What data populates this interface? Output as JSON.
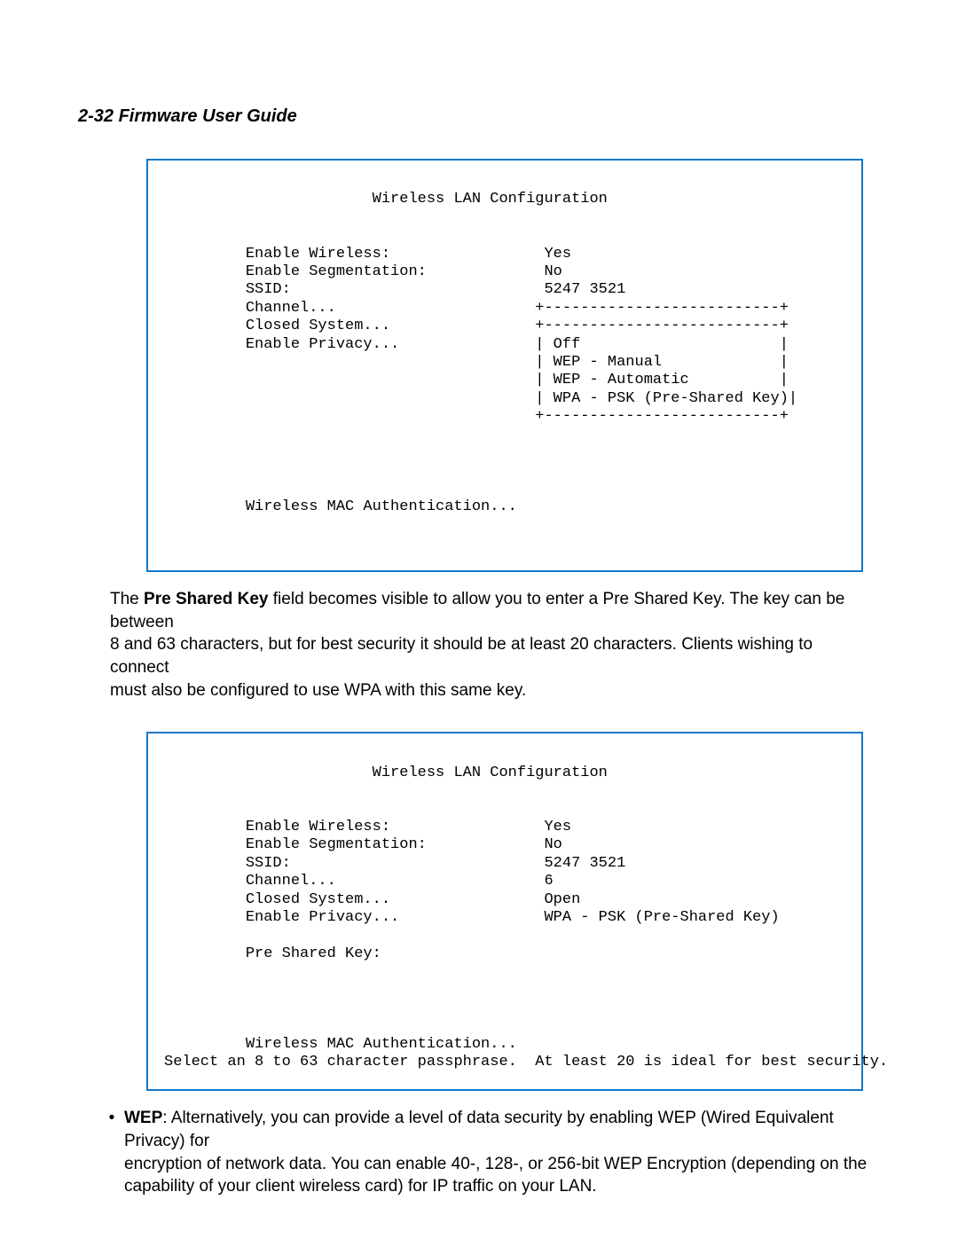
{
  "header": "2-32  Firmware User Guide",
  "term1": {
    "title": "                       Wireless LAN Configuration",
    "line_enable_wl": "         Enable Wireless:                 Yes",
    "line_enable_seg": "         Enable Segmentation:             No",
    "line_ssid": "         SSID:                            5247 3521",
    "line_channel": "         Channel...                      +--------------------------+",
    "line_closed": "         Closed System...                +--------------------------+",
    "line_priv_off": "         Enable Privacy...               | Off                      |",
    "line_priv_wepm": "                                         | WEP - Manual             |",
    "line_priv_wepa": "                                         | WEP - Automatic          |",
    "line_priv_wpa": "                                         | WPA - PSK (Pre-Shared Key)|",
    "line_priv_b": "                                         +--------------------------+",
    "line_wmac": "         Wireless MAC Authentication..."
  },
  "para1": {
    "lead": "The ",
    "bold": "Pre Shared Key",
    "rest1": " field becomes visible to allow you to enter a Pre Shared Key. The key can be between",
    "rest2": "8 and 63 characters, but for best security it should be at least 20 characters. Clients wishing to connect",
    "rest3": "must also be configured to use WPA with this same key."
  },
  "term2": {
    "title": "                       Wireless LAN Configuration",
    "line_enable_wl": "         Enable Wireless:                 Yes",
    "line_enable_seg": "         Enable Segmentation:             No",
    "line_ssid": "         SSID:                            5247 3521",
    "line_channel": "         Channel...                       6",
    "line_closed": "         Closed System...                 Open",
    "line_priv": "         Enable Privacy...                WPA - PSK (Pre-Shared Key)",
    "line_psk": "         Pre Shared Key:",
    "line_wmac": "         Wireless MAC Authentication...",
    "status": "Select an 8 to 63 character passphrase.  At least 20 is ideal for best security."
  },
  "bullet": {
    "dot": "•",
    "bold": "WEP",
    "rest1": ": Alternatively, you can provide a level of data security by enabling WEP (Wired Equivalent Privacy) for",
    "rest2": "encryption of network data. You can enable 40-, 128-, or 256-bit WEP Encryption (depending on the",
    "rest3": "capability of your client wireless card) for IP traffic on your LAN."
  }
}
